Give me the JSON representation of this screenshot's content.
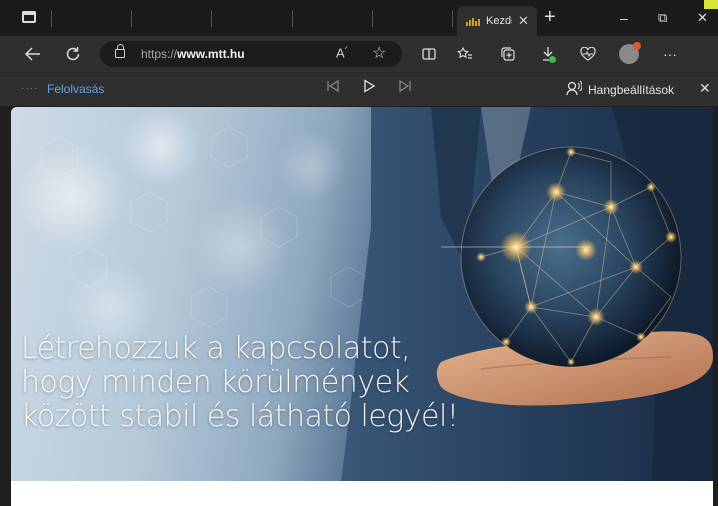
{
  "browser": {
    "tab": {
      "title": "Kezdőlap",
      "favicon_label": "mtt"
    },
    "address": {
      "url_prefix": "https://",
      "url_domain": "www.mtt.hu"
    },
    "icons": {
      "back": "back-arrow-icon",
      "refresh": "refresh-icon",
      "lock": "lock-icon",
      "read_aloud": "read-aloud-icon",
      "favorite": "favorite-star-icon",
      "split_screen": "split-screen-icon",
      "favorites": "favorites-icon",
      "collections": "collections-icon",
      "downloads": "downloads-icon",
      "health": "browser-essentials-icon",
      "profile": "profile-avatar-icon",
      "more": "more-icon"
    },
    "window_controls": {
      "minimize": "–",
      "maximize": "⧉",
      "close": "✕"
    },
    "read_aloud": {
      "label": "Felolvasás",
      "settings_label": "Hangbeállítások"
    }
  },
  "hero": {
    "heading_lines": [
      "Létrehozzuk a kapcsolatot,",
      "hogy minden körülmények",
      "között stabil és látható legyél!"
    ]
  },
  "colors": {
    "accent": "#63a4e8",
    "brand": "#c9a227"
  }
}
